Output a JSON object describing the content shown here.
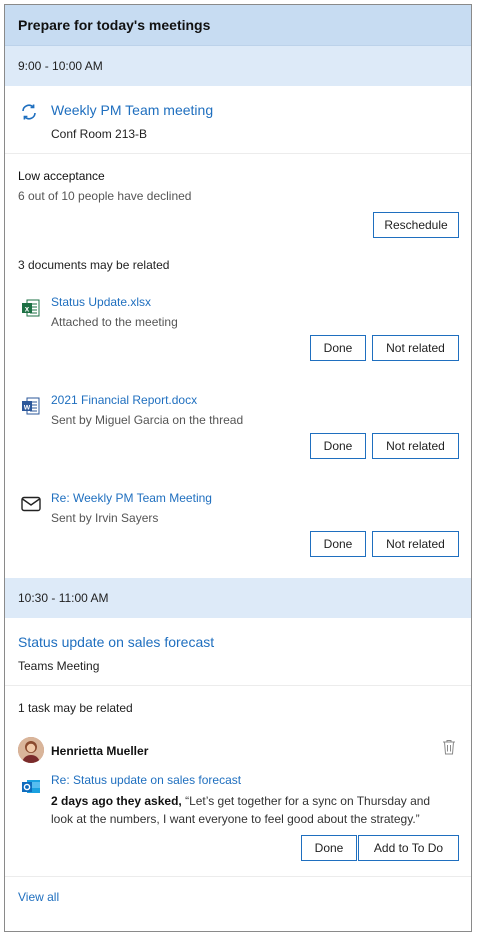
{
  "header": {
    "title": "Prepare for today's meetings"
  },
  "meeting1": {
    "time": "9:00 - 10:00 AM",
    "title": "Weekly PM Team meeting",
    "location": "Conf Room 213-B",
    "acceptance_title": "Low acceptance",
    "acceptance_detail": "6 out of 10 people have declined",
    "reschedule_label": "Reschedule",
    "docs_heading": "3 documents may be related",
    "docs": [
      {
        "name": "Status Update.xlsx",
        "detail": "Attached to the meeting",
        "icon": "excel-icon",
        "done": "Done",
        "not_related": "Not related"
      },
      {
        "name": "2021 Financial Report.docx",
        "detail": "Sent by Miguel Garcia on the thread",
        "icon": "word-icon",
        "done": "Done",
        "not_related": "Not related"
      },
      {
        "name": "Re: Weekly PM Team Meeting",
        "detail": "Sent by Irvin Sayers",
        "icon": "mail-icon",
        "done": "Done",
        "not_related": "Not related"
      }
    ]
  },
  "meeting2": {
    "time": "10:30 - 11:00 AM",
    "title": "Status update on sales forecast",
    "location": "Teams Meeting",
    "tasks_heading": "1 task may be related",
    "task": {
      "person": "Henrietta Mueller",
      "subject": "Re: Status update on sales forecast",
      "ago": "2 days ago they asked,",
      "quote": " “Let’s get together for a sync on Thursday and look at the numbers, I want everyone to feel good about the strategy.”",
      "done": "Done",
      "add": "Add to To Do"
    }
  },
  "footer": {
    "view_all": "View all"
  },
  "colors": {
    "accent": "#1f6fbf",
    "header_bg": "#c7dcf2",
    "time_bg": "#ddeaf8",
    "excel": "#1d7044",
    "word": "#2b579a",
    "outlook": "#0f6cbd"
  }
}
